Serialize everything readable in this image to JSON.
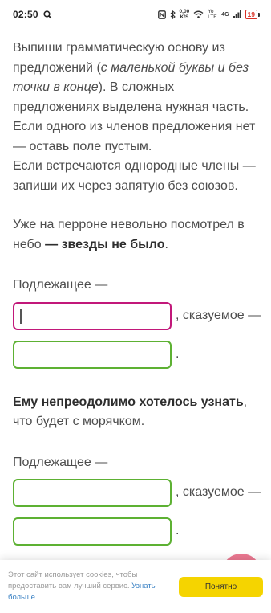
{
  "status_bar": {
    "time": "02:50",
    "net_speed_value": "0,00",
    "net_speed_unit": "K/S",
    "lte_label": "Yo LTE",
    "signal_label": "4G",
    "battery": "19"
  },
  "instructions": [
    {
      "before": "Выпиши грамматическую основу из предложений (",
      "em": "с маленькой буквы и без точки в конце",
      "after": "). В сложных предложениях выделена нужная часть."
    },
    {
      "before": "Если одного из членов предложения нет — оставь поле пустым.",
      "em": "",
      "after": ""
    },
    {
      "before": "Если встречаются однородные члены — запиши их через запятую без союзов.",
      "em": "",
      "after": ""
    }
  ],
  "task1": {
    "sentence_plain": "Уже на перроне невольно посмотрел в небо ",
    "sentence_bold": "— звезды не было",
    "sentence_end": ".",
    "subject_label": "Подлежащее —",
    "predicate_label": ", сказуемое —",
    "end_mark": "."
  },
  "task2": {
    "sentence_bold": "Ему непреодолимо хотелось узнать",
    "sentence_plain": ", что будет с морячком.",
    "subject_label": "Подлежащее —",
    "predicate_label": ", сказуемое —",
    "end_mark": "."
  },
  "cookie": {
    "text": "Этот сайт использует cookies, чтобы предоставить вам лучший сервис. ",
    "link": "Узнать больше",
    "button": "Понятно"
  },
  "colors": {
    "field_border": "#5db133",
    "active_border": "#c2187a",
    "cookie_button": "#f5d400",
    "fab": "#e8607e"
  }
}
